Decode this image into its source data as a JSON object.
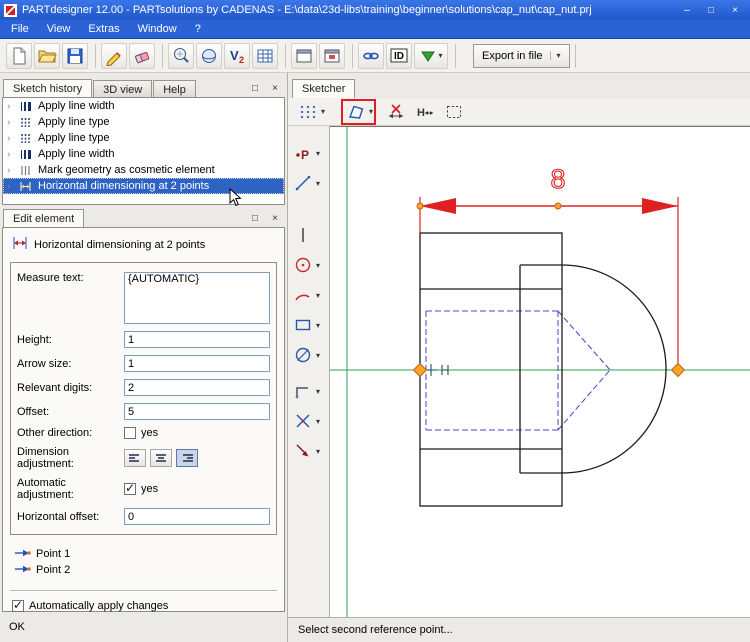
{
  "colors": {
    "titlebar": "#2760d4",
    "selection": "#2e63c4",
    "highlight_box": "#e02020",
    "dimension_red": "#e02020",
    "handle_orange": "#ffa228",
    "centerline_green": "#2f9e50",
    "hidden_blue": "#4646c8"
  },
  "glyphs": {
    "minimize": "–",
    "maximize": "□",
    "close": "×",
    "caret": "▾",
    "expander": "›",
    "panel_float": "□",
    "panel_close": "×"
  },
  "window": {
    "title": "PARTdesigner 12.00 - PARTsolutions by CADENAS - E:\\data\\23d-libs\\training\\beginner\\solutions\\cap_nut\\cap_nut.prj"
  },
  "menu": {
    "items": [
      {
        "label": "File"
      },
      {
        "label": "View"
      },
      {
        "label": "Extras"
      },
      {
        "label": "Window"
      },
      {
        "label": "?"
      }
    ]
  },
  "toolbar": {
    "export_label": "Export in file",
    "icons": [
      "new-document-icon",
      "open-folder-icon",
      "save-icon",
      "pencil-icon",
      "eraser-icon",
      "preview-zoom-icon",
      "sphere-icon",
      "variables-icon",
      "table-icon",
      "window-icon",
      "window-part-icon",
      "link-icon",
      "id-icon",
      "green-dropdown-icon"
    ]
  },
  "history": {
    "tabs": [
      {
        "label": "Sketch history"
      },
      {
        "label": "3D view"
      },
      {
        "label": "Help"
      }
    ],
    "items": [
      {
        "label": "Apply line width",
        "icon": "line-width-icon"
      },
      {
        "label": "Apply line type",
        "icon": "line-type-icon"
      },
      {
        "label": "Apply line type",
        "icon": "line-type-icon"
      },
      {
        "label": "Apply line width",
        "icon": "line-width-icon"
      },
      {
        "label": "Mark geometry as cosmetic element",
        "icon": "cosmetic-icon"
      },
      {
        "label": "Horizontal dimensioning at 2 points",
        "icon": "h-dimension-icon",
        "selected": true
      }
    ]
  },
  "edit": {
    "tab": "Edit element",
    "title": "Horizontal dimensioning at 2 points",
    "measure_label": "Measure text:",
    "measure_value": "{AUTOMATIC}",
    "height_label": "Height:",
    "height_value": "1",
    "arrow_label": "Arrow size:",
    "arrow_value": "1",
    "digits_label": "Relevant digits:",
    "digits_value": "2",
    "offset_label": "Offset:",
    "offset_value": "5",
    "other_label": "Other direction:",
    "other_yes": "yes",
    "other_checked": false,
    "adjust_label": "Dimension adjustment:",
    "adjust_selected_index": 2,
    "auto_label": "Automatic adjustment:",
    "auto_yes": "yes",
    "auto_checked": true,
    "hoffset_label": "Horizontal offset:",
    "hoffset_value": "0",
    "point1": "Point 1",
    "point2": "Point 2",
    "apply_label": "Automatically apply changes",
    "apply_checked": true,
    "ok_label": "OK"
  },
  "sketcher": {
    "tab": "Sketcher",
    "toolbar_icons": [
      "grid-snap-icon",
      "dimension-tool-icon",
      "delete-dimension-icon",
      "horizontal-dimension-icon",
      "selection-box-icon"
    ],
    "tools": [
      "point-tool",
      "line-tool",
      "polyline-tool",
      "circle-tool",
      "arc-tool",
      "rectangle-tool",
      "ellipse-tool",
      "fillet-tool",
      "trim-tool",
      "move-tool"
    ],
    "dim_label": "8",
    "status": "Select second reference point..."
  }
}
